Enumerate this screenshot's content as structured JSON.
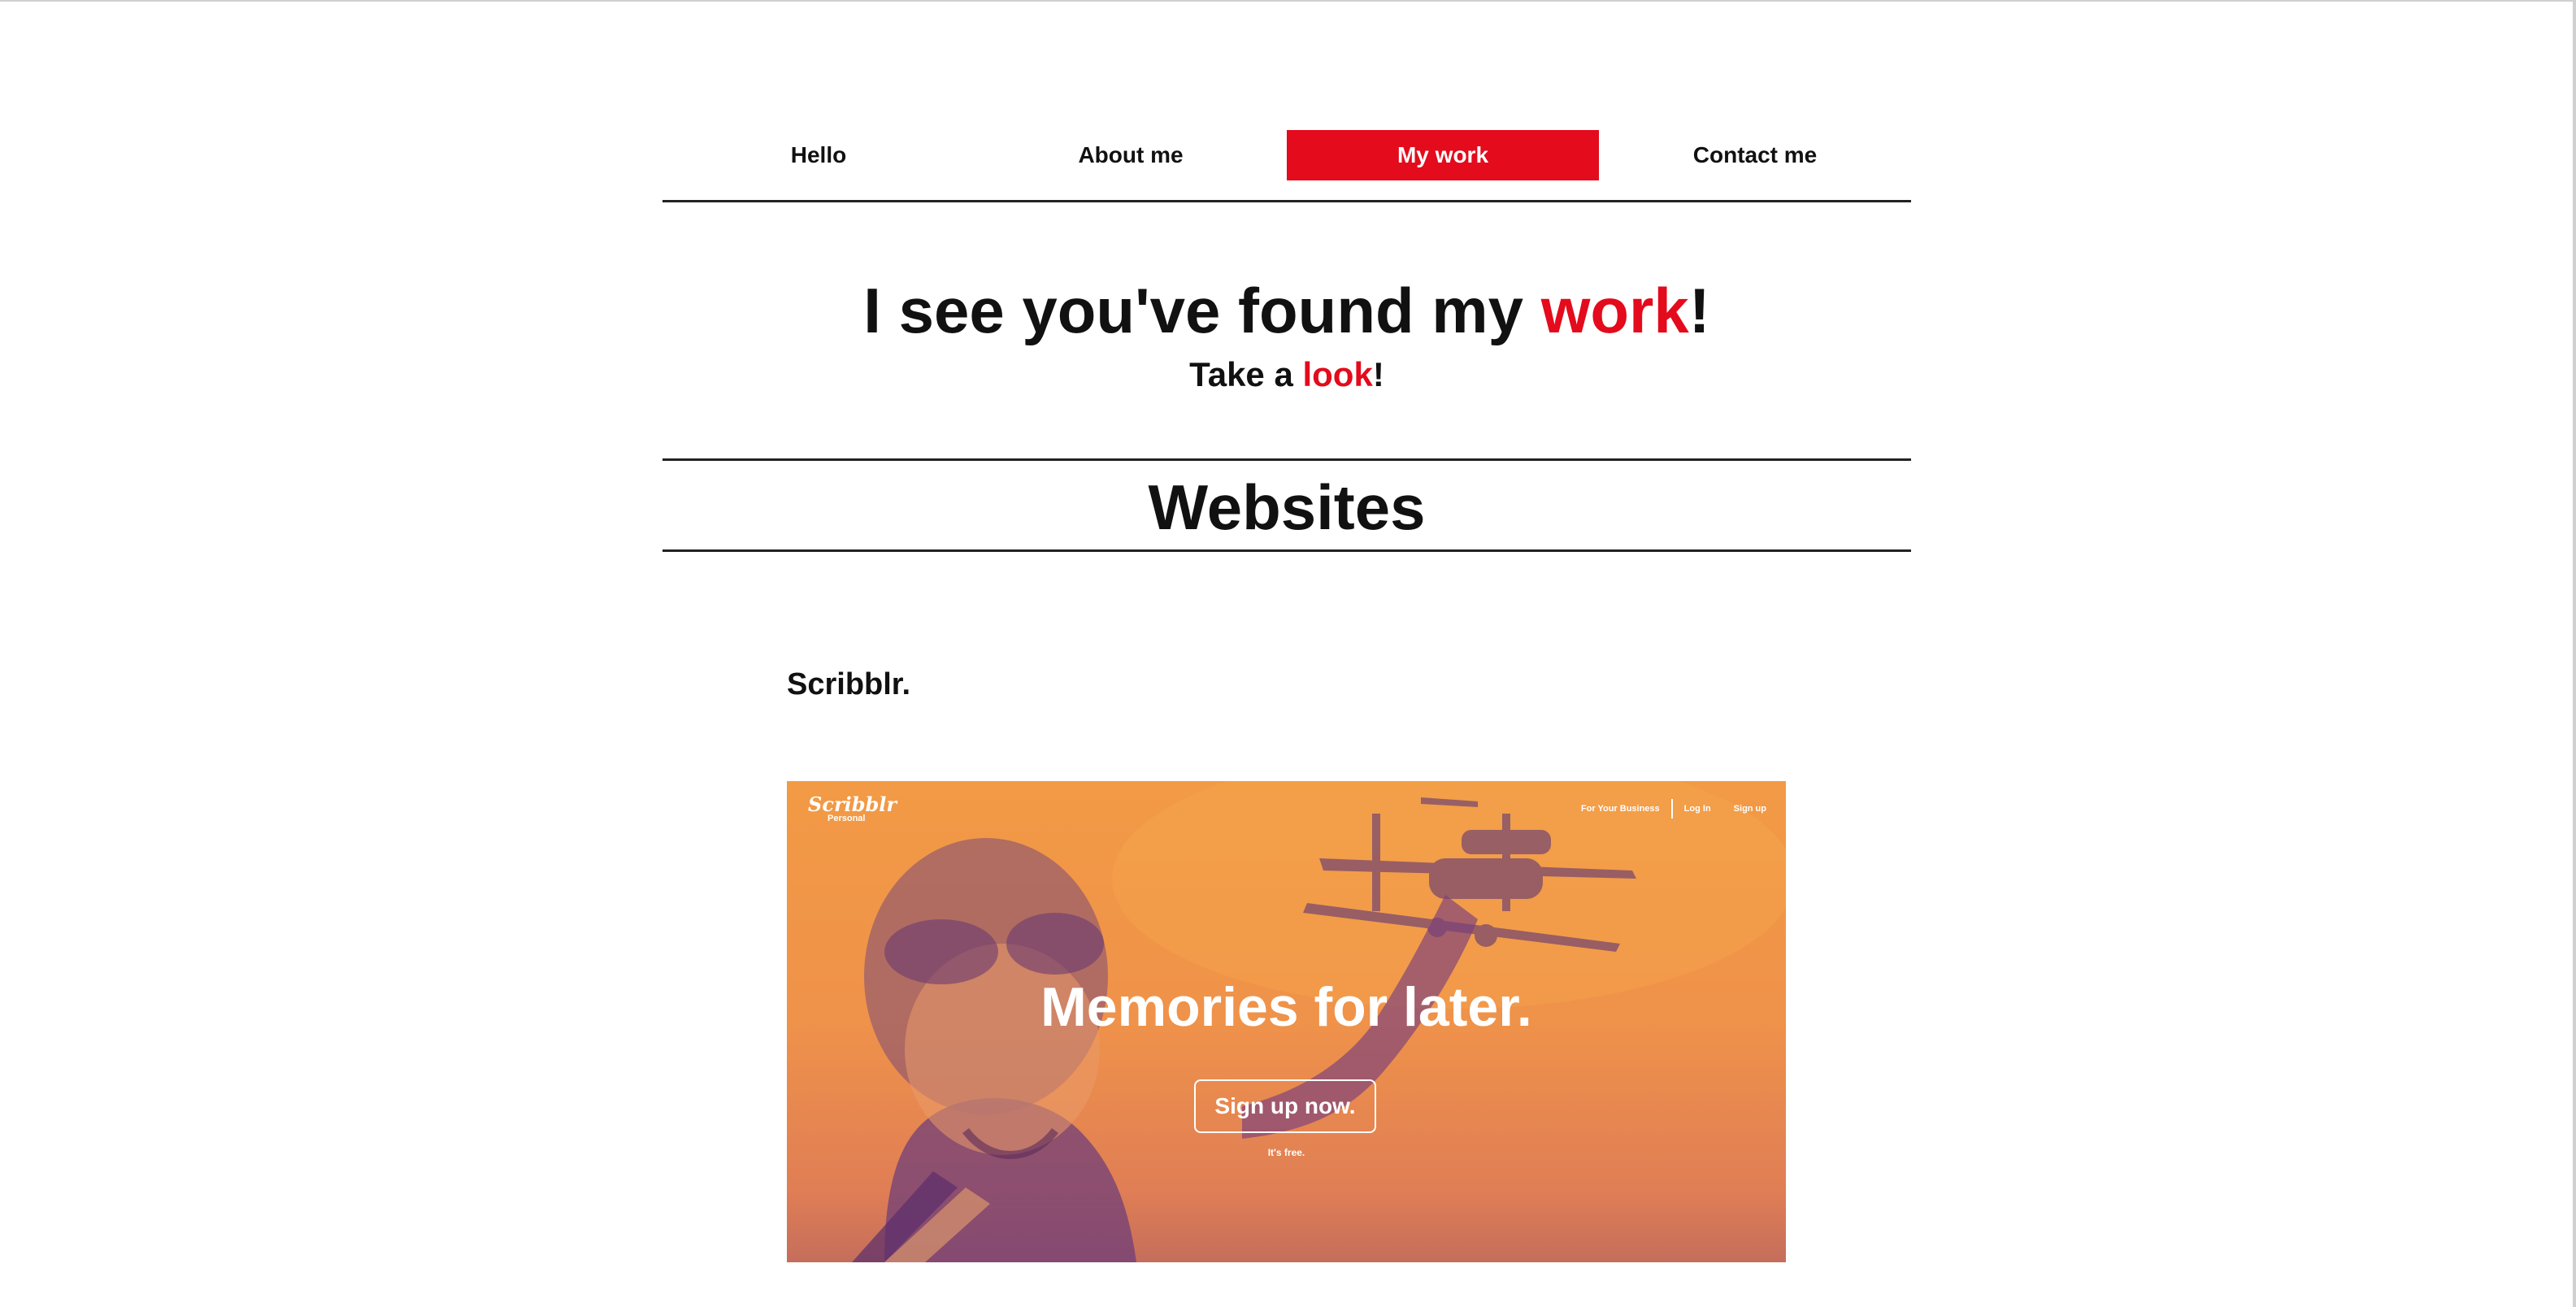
{
  "nav": {
    "items": [
      {
        "label": "Hello",
        "active": false
      },
      {
        "label": "About me",
        "active": false
      },
      {
        "label": "My work",
        "active": true
      },
      {
        "label": "Contact me",
        "active": false
      }
    ]
  },
  "hero": {
    "title_main": "I see you've found my ",
    "title_accent": "work",
    "title_end": "!",
    "subtitle_main": "Take a ",
    "subtitle_accent": "look",
    "subtitle_end": "!"
  },
  "section": {
    "title": "Websites"
  },
  "project": {
    "title": "Scribblr.",
    "preview": {
      "logo": "Scribblr",
      "logo_sub": "Personal",
      "nav": [
        "For Your Business",
        "Log In",
        "Sign up"
      ],
      "headline": "Memories for later.",
      "button": "Sign up now.",
      "note": "It's free."
    }
  },
  "colors": {
    "accent": "#e30b1c",
    "text": "#111111",
    "preview_orange": "#f29a45",
    "preview_purple": "#6a3a7a"
  }
}
